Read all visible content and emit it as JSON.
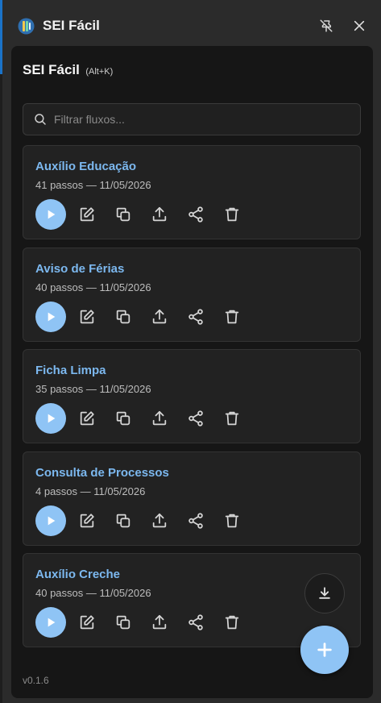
{
  "window": {
    "title": "SEI Fácil",
    "pin_icon": "pin-off-icon",
    "close_icon": "close-icon"
  },
  "panel": {
    "title": "SEI Fácil",
    "shortcut": "(Alt+K)"
  },
  "search": {
    "placeholder": "Filtrar fluxos...",
    "value": ""
  },
  "flows": [
    {
      "name": "Auxílio Educação",
      "meta": "41 passos — 11/05/2026"
    },
    {
      "name": "Aviso de Férias",
      "meta": "40 passos — 11/05/2026"
    },
    {
      "name": "Ficha Limpa",
      "meta": "35 passos — 11/05/2026"
    },
    {
      "name": "Consulta de Processos",
      "meta": "4 passos — 11/05/2026"
    },
    {
      "name": "Auxílio Creche",
      "meta": "40 passos — 11/05/2026"
    }
  ],
  "actions": [
    "play-icon",
    "edit-icon",
    "copy-icon",
    "export-icon",
    "share-icon",
    "trash-icon"
  ],
  "fab": {
    "import_icon": "download-icon",
    "add_label": "+"
  },
  "version": "v0.1.6",
  "colors": {
    "accent": "#8fc4f5",
    "flow_name": "#7cb8ef",
    "panel_bg": "#161616",
    "card_bg": "#222222"
  }
}
